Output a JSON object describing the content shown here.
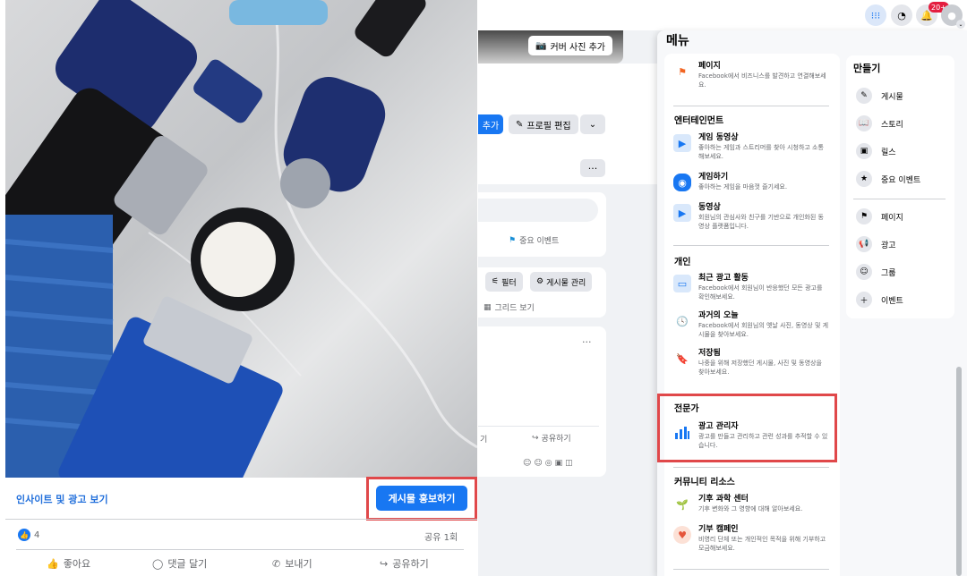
{
  "background": {
    "cover_button": "커버 사진 추가",
    "add_button": "추가",
    "edit_profile_button": "프로필 편집",
    "more_button": "···",
    "important_event": "중요 이벤트",
    "filter_button": "필터",
    "manage_posts_button": "게시물 관리",
    "grid_view": "그리드 보기",
    "comment_partial": "기",
    "share_label": "공유하기",
    "more2": "···"
  },
  "topbar": {
    "notification_badge": "20+"
  },
  "post": {
    "insight_link": "인사이트 및 광고 보기",
    "promote_button": "게시물 홍보하기",
    "like_count": "4",
    "share_count": "공유 1회",
    "actions": {
      "like": "좋아요",
      "comment": "댓글 달기",
      "send": "보내기",
      "share": "공유하기"
    }
  },
  "menu": {
    "title": "메뉴",
    "items": {
      "pages": {
        "label": "페이지",
        "desc": "Facebook에서 비즈니스를 발견하고 연결해보세요."
      },
      "entertainment_title": "엔터테인먼트",
      "gaming_video": {
        "label": "게임 동영상",
        "desc": "좋아하는 게임과 스트리머를 찾아 시청하고 소통해보세요."
      },
      "play_games": {
        "label": "게임하기",
        "desc": "좋아하는 게임을 마음껏 즐기세요."
      },
      "video": {
        "label": "동영상",
        "desc": "회원님의 관심사와 친구를 기반으로 개인화된 동영상 플랫폼입니다."
      },
      "personal_title": "개인",
      "recent_ad_activity": {
        "label": "최근 광고 활동",
        "desc": "Facebook에서 회원님이 반응했던 모든 광고를 확인해보세요."
      },
      "memories": {
        "label": "과거의 오늘",
        "desc": "Facebook에서 회원님의 옛날 사진, 동영상 및 게시물을 찾아보세요."
      },
      "saved": {
        "label": "저장됨",
        "desc": "나중을 위해 저장했던 게시물, 사진 및 동영상을 찾아보세요."
      },
      "professional_title": "전문가",
      "ads_manager": {
        "label": "광고 관리자",
        "desc": "광고를 만들고 관리하고 관련 성과를 추적할 수 있습니다."
      },
      "community_title": "커뮤니티 리소스",
      "climate_center": {
        "label": "기후 과학 센터",
        "desc": "기후 변화와 그 영향에 대해 알아보세요."
      },
      "fundraisers": {
        "label": "기부 캠페인",
        "desc": "비영리 단체 또는 개인적인 목적을 위해 기부하고 모금해보세요."
      }
    },
    "create": {
      "title": "만들기",
      "post": "게시물",
      "story": "스토리",
      "reels": "릴스",
      "life_event": "중요 이벤트",
      "page": "페이지",
      "ad": "광고",
      "group": "그룹",
      "event": "이벤트"
    }
  }
}
